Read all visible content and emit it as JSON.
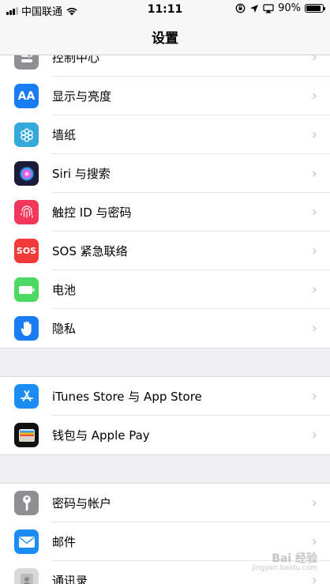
{
  "status_bar": {
    "carrier": "中国联通",
    "time": "11:11",
    "battery": "90%",
    "battery_level": 0.9
  },
  "nav": {
    "title": "设置"
  },
  "groups": [
    [
      {
        "label": "控制中心",
        "icon": "control-center-icon",
        "color": "#8e8e93"
      },
      {
        "label": "显示与亮度",
        "icon": "display-brightness-icon",
        "color": "#1a7cf3",
        "glyph": "AA"
      },
      {
        "label": "墙纸",
        "icon": "wallpaper-icon",
        "color": "#34aadc"
      },
      {
        "label": "Siri 与搜索",
        "icon": "siri-icon",
        "color": "#1c1c3a"
      },
      {
        "label": "触控 ID 与密码",
        "icon": "fingerprint-icon",
        "color": "#f2385a"
      },
      {
        "label": "SOS 紧急联络",
        "icon": "sos-icon",
        "color": "#f23a3a",
        "glyph": "SOS"
      },
      {
        "label": "电池",
        "icon": "battery-icon",
        "color": "#4cd964"
      },
      {
        "label": "隐私",
        "icon": "privacy-hand-icon",
        "color": "#1a7cf3"
      }
    ],
    [
      {
        "label": "iTunes Store 与 App Store",
        "icon": "app-store-icon",
        "color": "#1a8cf3"
      },
      {
        "label": "钱包与 Apple Pay",
        "icon": "wallet-icon",
        "color": "#111111"
      }
    ],
    [
      {
        "label": "密码与帐户",
        "icon": "key-icon",
        "color": "#8e8e93"
      },
      {
        "label": "邮件",
        "icon": "mail-icon",
        "color": "#1a8cf3"
      },
      {
        "label": "通讯录",
        "icon": "contacts-icon",
        "color": "#d8d8d8"
      }
    ]
  ],
  "chevron": "›",
  "watermark": {
    "text": "Bai 经验",
    "sub": "jingyan.baidu.com"
  }
}
